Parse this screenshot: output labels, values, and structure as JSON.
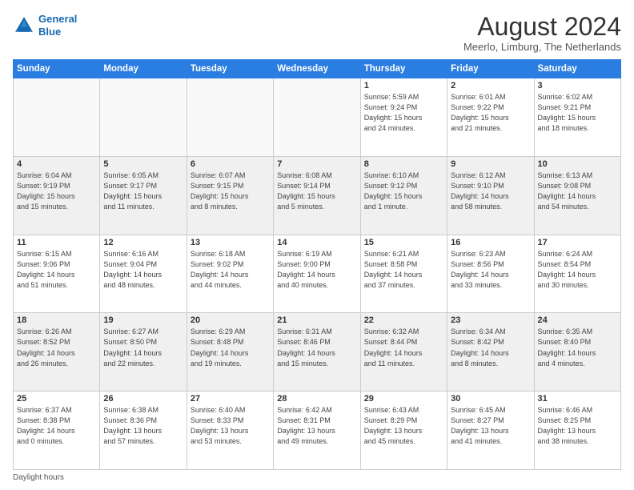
{
  "header": {
    "logo_line1": "General",
    "logo_line2": "Blue",
    "month_title": "August 2024",
    "location": "Meerlo, Limburg, The Netherlands"
  },
  "days_of_week": [
    "Sunday",
    "Monday",
    "Tuesday",
    "Wednesday",
    "Thursday",
    "Friday",
    "Saturday"
  ],
  "footer": "Daylight hours",
  "weeks": [
    [
      {
        "day": "",
        "info": ""
      },
      {
        "day": "",
        "info": ""
      },
      {
        "day": "",
        "info": ""
      },
      {
        "day": "",
        "info": ""
      },
      {
        "day": "1",
        "info": "Sunrise: 5:59 AM\nSunset: 9:24 PM\nDaylight: 15 hours\nand 24 minutes."
      },
      {
        "day": "2",
        "info": "Sunrise: 6:01 AM\nSunset: 9:22 PM\nDaylight: 15 hours\nand 21 minutes."
      },
      {
        "day": "3",
        "info": "Sunrise: 6:02 AM\nSunset: 9:21 PM\nDaylight: 15 hours\nand 18 minutes."
      }
    ],
    [
      {
        "day": "4",
        "info": "Sunrise: 6:04 AM\nSunset: 9:19 PM\nDaylight: 15 hours\nand 15 minutes."
      },
      {
        "day": "5",
        "info": "Sunrise: 6:05 AM\nSunset: 9:17 PM\nDaylight: 15 hours\nand 11 minutes."
      },
      {
        "day": "6",
        "info": "Sunrise: 6:07 AM\nSunset: 9:15 PM\nDaylight: 15 hours\nand 8 minutes."
      },
      {
        "day": "7",
        "info": "Sunrise: 6:08 AM\nSunset: 9:14 PM\nDaylight: 15 hours\nand 5 minutes."
      },
      {
        "day": "8",
        "info": "Sunrise: 6:10 AM\nSunset: 9:12 PM\nDaylight: 15 hours\nand 1 minute."
      },
      {
        "day": "9",
        "info": "Sunrise: 6:12 AM\nSunset: 9:10 PM\nDaylight: 14 hours\nand 58 minutes."
      },
      {
        "day": "10",
        "info": "Sunrise: 6:13 AM\nSunset: 9:08 PM\nDaylight: 14 hours\nand 54 minutes."
      }
    ],
    [
      {
        "day": "11",
        "info": "Sunrise: 6:15 AM\nSunset: 9:06 PM\nDaylight: 14 hours\nand 51 minutes."
      },
      {
        "day": "12",
        "info": "Sunrise: 6:16 AM\nSunset: 9:04 PM\nDaylight: 14 hours\nand 48 minutes."
      },
      {
        "day": "13",
        "info": "Sunrise: 6:18 AM\nSunset: 9:02 PM\nDaylight: 14 hours\nand 44 minutes."
      },
      {
        "day": "14",
        "info": "Sunrise: 6:19 AM\nSunset: 9:00 PM\nDaylight: 14 hours\nand 40 minutes."
      },
      {
        "day": "15",
        "info": "Sunrise: 6:21 AM\nSunset: 8:58 PM\nDaylight: 14 hours\nand 37 minutes."
      },
      {
        "day": "16",
        "info": "Sunrise: 6:23 AM\nSunset: 8:56 PM\nDaylight: 14 hours\nand 33 minutes."
      },
      {
        "day": "17",
        "info": "Sunrise: 6:24 AM\nSunset: 8:54 PM\nDaylight: 14 hours\nand 30 minutes."
      }
    ],
    [
      {
        "day": "18",
        "info": "Sunrise: 6:26 AM\nSunset: 8:52 PM\nDaylight: 14 hours\nand 26 minutes."
      },
      {
        "day": "19",
        "info": "Sunrise: 6:27 AM\nSunset: 8:50 PM\nDaylight: 14 hours\nand 22 minutes."
      },
      {
        "day": "20",
        "info": "Sunrise: 6:29 AM\nSunset: 8:48 PM\nDaylight: 14 hours\nand 19 minutes."
      },
      {
        "day": "21",
        "info": "Sunrise: 6:31 AM\nSunset: 8:46 PM\nDaylight: 14 hours\nand 15 minutes."
      },
      {
        "day": "22",
        "info": "Sunrise: 6:32 AM\nSunset: 8:44 PM\nDaylight: 14 hours\nand 11 minutes."
      },
      {
        "day": "23",
        "info": "Sunrise: 6:34 AM\nSunset: 8:42 PM\nDaylight: 14 hours\nand 8 minutes."
      },
      {
        "day": "24",
        "info": "Sunrise: 6:35 AM\nSunset: 8:40 PM\nDaylight: 14 hours\nand 4 minutes."
      }
    ],
    [
      {
        "day": "25",
        "info": "Sunrise: 6:37 AM\nSunset: 8:38 PM\nDaylight: 14 hours\nand 0 minutes."
      },
      {
        "day": "26",
        "info": "Sunrise: 6:38 AM\nSunset: 8:36 PM\nDaylight: 13 hours\nand 57 minutes."
      },
      {
        "day": "27",
        "info": "Sunrise: 6:40 AM\nSunset: 8:33 PM\nDaylight: 13 hours\nand 53 minutes."
      },
      {
        "day": "28",
        "info": "Sunrise: 6:42 AM\nSunset: 8:31 PM\nDaylight: 13 hours\nand 49 minutes."
      },
      {
        "day": "29",
        "info": "Sunrise: 6:43 AM\nSunset: 8:29 PM\nDaylight: 13 hours\nand 45 minutes."
      },
      {
        "day": "30",
        "info": "Sunrise: 6:45 AM\nSunset: 8:27 PM\nDaylight: 13 hours\nand 41 minutes."
      },
      {
        "day": "31",
        "info": "Sunrise: 6:46 AM\nSunset: 8:25 PM\nDaylight: 13 hours\nand 38 minutes."
      }
    ]
  ]
}
